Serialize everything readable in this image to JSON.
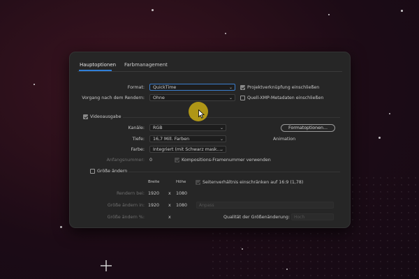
{
  "tabs": [
    {
      "label": "Hauptoptionen",
      "active": true
    },
    {
      "label": "Farbmanagement",
      "active": false
    }
  ],
  "format": {
    "label": "Format:",
    "value": "QuickTime"
  },
  "post_render": {
    "label": "Vorgang nach dem Rendern:",
    "value": "Ohne"
  },
  "include_project_link": {
    "label": "Projektverknüpfung einschließen",
    "checked": true
  },
  "include_xmp": {
    "label": "Quell-XMP-Metadaten einschließen",
    "checked": false
  },
  "video_output": {
    "label": "Videoausgabe",
    "checked": true,
    "channels": {
      "label": "Kanäle:",
      "value": "RGB"
    },
    "depth": {
      "label": "Tiefe:",
      "value": "16,7 Mill. Farben"
    },
    "color": {
      "label": "Farbe:",
      "value": "Integriert (mit Schwarz mask..."
    },
    "format_options_button": "Formatoptionen...",
    "codec_text": "Animation",
    "start_number": {
      "label": "Anfangsnummer:",
      "value": "0"
    },
    "comp_frame_number": {
      "label": "Kompositions-Framenummer verwenden",
      "checked": true
    }
  },
  "resize": {
    "label": "Größe ändern",
    "checked": false,
    "width_header": "Breite",
    "height_header": "Höhe",
    "aspect_lock": {
      "label": "Seitenverhältnis einschränken auf 16:9 (1,78)",
      "checked": true
    },
    "rendering_at": {
      "label": "Rendern bei:",
      "width": "1920",
      "x": "x",
      "height": "1080"
    },
    "resize_to": {
      "label": "Größe ändern in:",
      "width": "1920",
      "x": "x",
      "height": "1080",
      "preset": "Anpass"
    },
    "resize_pct": {
      "label": "Größe ändern %:",
      "x": "x",
      "quality_label": "Qualität der Größenänderung:",
      "quality": "Hoch"
    }
  },
  "colors": {
    "accent": "#2f7fd8",
    "cursor_highlight": "#c8aa14"
  }
}
